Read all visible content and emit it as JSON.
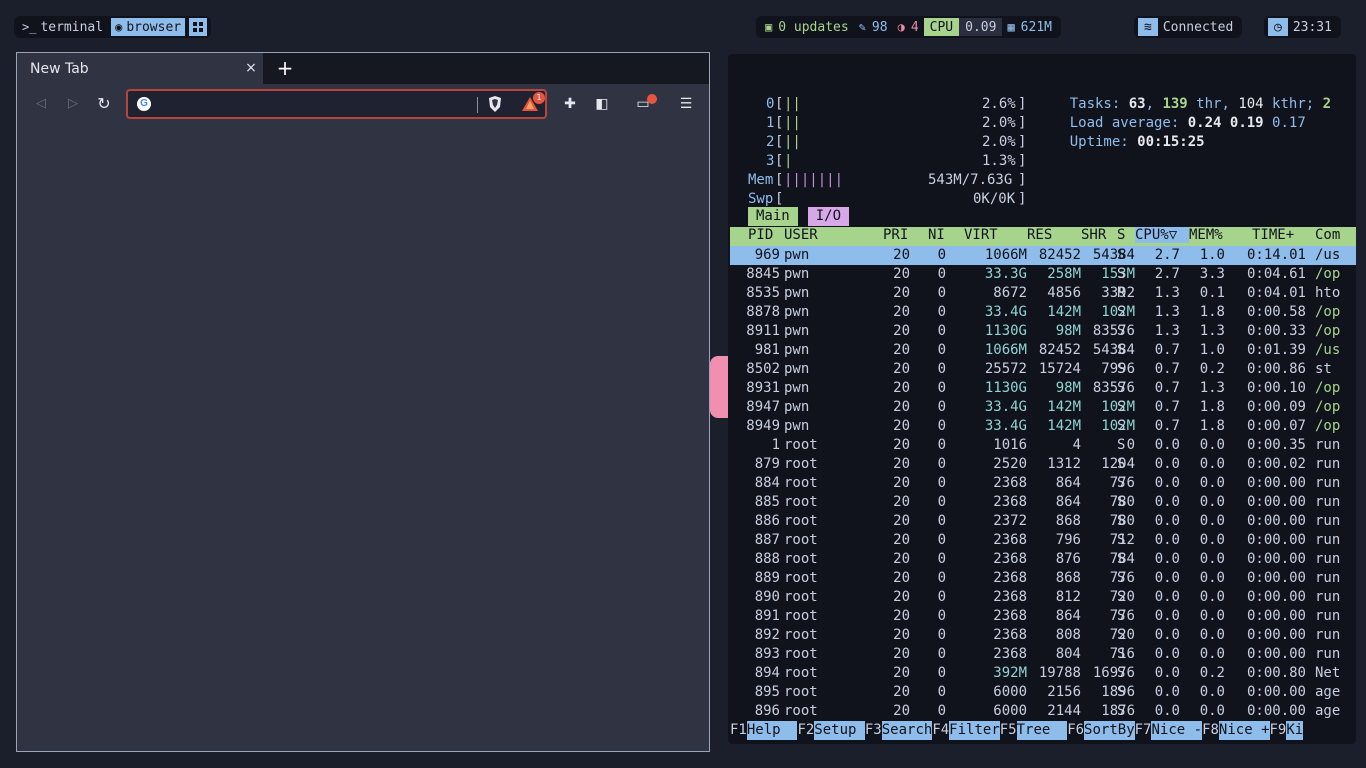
{
  "topbar": {
    "workspaces": [
      {
        "label": "terminal",
        "glyph": ">_",
        "active": false
      },
      {
        "label": "browser",
        "glyph": "◉",
        "active": true
      }
    ],
    "updates": "0 updates",
    "plugins": "98",
    "alerts": "4",
    "cpu_label": "CPU",
    "cpu_value": "0.09",
    "mem_value": "621M",
    "network": "Connected",
    "clock": "23:31"
  },
  "browser": {
    "tab_title": "New Tab",
    "tab_close": "×",
    "new_tab": "+",
    "address_value": "",
    "rewards_badge": "1"
  },
  "htop": {
    "cpus": [
      {
        "id": "0",
        "bars": "||",
        "pct": "2.6%"
      },
      {
        "id": "1",
        "bars": "||",
        "pct": "2.0%"
      },
      {
        "id": "2",
        "bars": "||",
        "pct": "2.0%"
      },
      {
        "id": "3",
        "bars": "|",
        "pct": "1.3%"
      }
    ],
    "mem": {
      "label": "Mem",
      "bars": "|||||||",
      "value": "543M/7.63G"
    },
    "swp": {
      "label": "Swp",
      "value": "0K/0K"
    },
    "tasks_label": "Tasks: ",
    "tasks": "63",
    "threads": "139",
    "threads_label": " thr, ",
    "kthreads": "104",
    "kthr_label": " kthr; ",
    "running": "2",
    "load_label": "Load average: ",
    "load1": "0.24",
    "load5": "0.19",
    "load15": "0.17",
    "uptime_label": "Uptime: ",
    "uptime": "00:15:25",
    "tab_main": "Main",
    "tab_io": "I/O",
    "columns": [
      "PID",
      "USER",
      "PRI",
      "NI",
      "VIRT",
      "RES",
      "SHR",
      "S",
      "CPU%▽",
      "MEM%",
      "TIME+",
      "Com"
    ],
    "processes": [
      {
        "pid": "969",
        "user": "pwn",
        "pri": "20",
        "ni": "0",
        "virt": "1066M",
        "res": "82452",
        "shr": "54384",
        "s": "S",
        "cpu": "2.7",
        "mem": "1.0",
        "time": "0:14.01",
        "cmd": "/us"
      },
      {
        "pid": "8845",
        "user": "pwn",
        "pri": "20",
        "ni": "0",
        "virt": "33.3G",
        "res": "258M",
        "shr": "153M",
        "s": "S",
        "cpu": "2.7",
        "mem": "3.3",
        "time": "0:04.61",
        "cmd": "/op"
      },
      {
        "pid": "8535",
        "user": "pwn",
        "pri": "20",
        "ni": "0",
        "virt": "8672",
        "res": "4856",
        "shr": "3392",
        "s": "R",
        "cpu": "1.3",
        "mem": "0.1",
        "time": "0:04.01",
        "cmd": "hto"
      },
      {
        "pid": "8878",
        "user": "pwn",
        "pri": "20",
        "ni": "0",
        "virt": "33.4G",
        "res": "142M",
        "shr": "102M",
        "s": "S",
        "cpu": "1.3",
        "mem": "1.8",
        "time": "0:00.58",
        "cmd": "/op"
      },
      {
        "pid": "8911",
        "user": "pwn",
        "pri": "20",
        "ni": "0",
        "virt": "1130G",
        "res": "98M",
        "shr": "83576",
        "s": "S",
        "cpu": "1.3",
        "mem": "1.3",
        "time": "0:00.33",
        "cmd": "/op"
      },
      {
        "pid": "981",
        "user": "pwn",
        "pri": "20",
        "ni": "0",
        "virt": "1066M",
        "res": "82452",
        "shr": "54384",
        "s": "S",
        "cpu": "0.7",
        "mem": "1.0",
        "time": "0:01.39",
        "cmd": "/us"
      },
      {
        "pid": "8502",
        "user": "pwn",
        "pri": "20",
        "ni": "0",
        "virt": "25572",
        "res": "15724",
        "shr": "7996",
        "s": "S",
        "cpu": "0.7",
        "mem": "0.2",
        "time": "0:00.86",
        "cmd": "st"
      },
      {
        "pid": "8931",
        "user": "pwn",
        "pri": "20",
        "ni": "0",
        "virt": "1130G",
        "res": "98M",
        "shr": "83576",
        "s": "S",
        "cpu": "0.7",
        "mem": "1.3",
        "time": "0:00.10",
        "cmd": "/op"
      },
      {
        "pid": "8947",
        "user": "pwn",
        "pri": "20",
        "ni": "0",
        "virt": "33.4G",
        "res": "142M",
        "shr": "102M",
        "s": "S",
        "cpu": "0.7",
        "mem": "1.8",
        "time": "0:00.09",
        "cmd": "/op"
      },
      {
        "pid": "8949",
        "user": "pwn",
        "pri": "20",
        "ni": "0",
        "virt": "33.4G",
        "res": "142M",
        "shr": "102M",
        "s": "S",
        "cpu": "0.7",
        "mem": "1.8",
        "time": "0:00.07",
        "cmd": "/op"
      },
      {
        "pid": "1",
        "user": "root",
        "pri": "20",
        "ni": "0",
        "virt": "1016",
        "res": "4",
        "shr": "0",
        "s": "S",
        "cpu": "0.0",
        "mem": "0.0",
        "time": "0:00.35",
        "cmd": "run"
      },
      {
        "pid": "879",
        "user": "root",
        "pri": "20",
        "ni": "0",
        "virt": "2520",
        "res": "1312",
        "shr": "1204",
        "s": "S",
        "cpu": "0.0",
        "mem": "0.0",
        "time": "0:00.02",
        "cmd": "run"
      },
      {
        "pid": "884",
        "user": "root",
        "pri": "20",
        "ni": "0",
        "virt": "2368",
        "res": "864",
        "shr": "776",
        "s": "S",
        "cpu": "0.0",
        "mem": "0.0",
        "time": "0:00.00",
        "cmd": "run"
      },
      {
        "pid": "885",
        "user": "root",
        "pri": "20",
        "ni": "0",
        "virt": "2368",
        "res": "864",
        "shr": "780",
        "s": "S",
        "cpu": "0.0",
        "mem": "0.0",
        "time": "0:00.00",
        "cmd": "run"
      },
      {
        "pid": "886",
        "user": "root",
        "pri": "20",
        "ni": "0",
        "virt": "2372",
        "res": "868",
        "shr": "780",
        "s": "S",
        "cpu": "0.0",
        "mem": "0.0",
        "time": "0:00.00",
        "cmd": "run"
      },
      {
        "pid": "887",
        "user": "root",
        "pri": "20",
        "ni": "0",
        "virt": "2368",
        "res": "796",
        "shr": "712",
        "s": "S",
        "cpu": "0.0",
        "mem": "0.0",
        "time": "0:00.00",
        "cmd": "run"
      },
      {
        "pid": "888",
        "user": "root",
        "pri": "20",
        "ni": "0",
        "virt": "2368",
        "res": "876",
        "shr": "784",
        "s": "S",
        "cpu": "0.0",
        "mem": "0.0",
        "time": "0:00.00",
        "cmd": "run"
      },
      {
        "pid": "889",
        "user": "root",
        "pri": "20",
        "ni": "0",
        "virt": "2368",
        "res": "868",
        "shr": "776",
        "s": "S",
        "cpu": "0.0",
        "mem": "0.0",
        "time": "0:00.00",
        "cmd": "run"
      },
      {
        "pid": "890",
        "user": "root",
        "pri": "20",
        "ni": "0",
        "virt": "2368",
        "res": "812",
        "shr": "720",
        "s": "S",
        "cpu": "0.0",
        "mem": "0.0",
        "time": "0:00.00",
        "cmd": "run"
      },
      {
        "pid": "891",
        "user": "root",
        "pri": "20",
        "ni": "0",
        "virt": "2368",
        "res": "864",
        "shr": "776",
        "s": "S",
        "cpu": "0.0",
        "mem": "0.0",
        "time": "0:00.00",
        "cmd": "run"
      },
      {
        "pid": "892",
        "user": "root",
        "pri": "20",
        "ni": "0",
        "virt": "2368",
        "res": "808",
        "shr": "720",
        "s": "S",
        "cpu": "0.0",
        "mem": "0.0",
        "time": "0:00.00",
        "cmd": "run"
      },
      {
        "pid": "893",
        "user": "root",
        "pri": "20",
        "ni": "0",
        "virt": "2368",
        "res": "804",
        "shr": "716",
        "s": "S",
        "cpu": "0.0",
        "mem": "0.0",
        "time": "0:00.00",
        "cmd": "run"
      },
      {
        "pid": "894",
        "user": "root",
        "pri": "20",
        "ni": "0",
        "virt": "392M",
        "res": "19788",
        "shr": "16976",
        "s": "S",
        "cpu": "0.0",
        "mem": "0.2",
        "time": "0:00.80",
        "cmd": "Net"
      },
      {
        "pid": "895",
        "user": "root",
        "pri": "20",
        "ni": "0",
        "virt": "6000",
        "res": "2156",
        "shr": "1896",
        "s": "S",
        "cpu": "0.0",
        "mem": "0.0",
        "time": "0:00.00",
        "cmd": "age"
      },
      {
        "pid": "896",
        "user": "root",
        "pri": "20",
        "ni": "0",
        "virt": "6000",
        "res": "2144",
        "shr": "1876",
        "s": "S",
        "cpu": "0.0",
        "mem": "0.0",
        "time": "0:00.00",
        "cmd": "age"
      }
    ],
    "fkeys": [
      {
        "key": "F1",
        "label": "Help  "
      },
      {
        "key": "F2",
        "label": "Setup "
      },
      {
        "key": "F3",
        "label": "Search"
      },
      {
        "key": "F4",
        "label": "Filter"
      },
      {
        "key": "F5",
        "label": "Tree  "
      },
      {
        "key": "F6",
        "label": "SortBy"
      },
      {
        "key": "F7",
        "label": "Nice -"
      },
      {
        "key": "F8",
        "label": "Nice +"
      },
      {
        "key": "F9",
        "label": "Ki"
      }
    ]
  }
}
